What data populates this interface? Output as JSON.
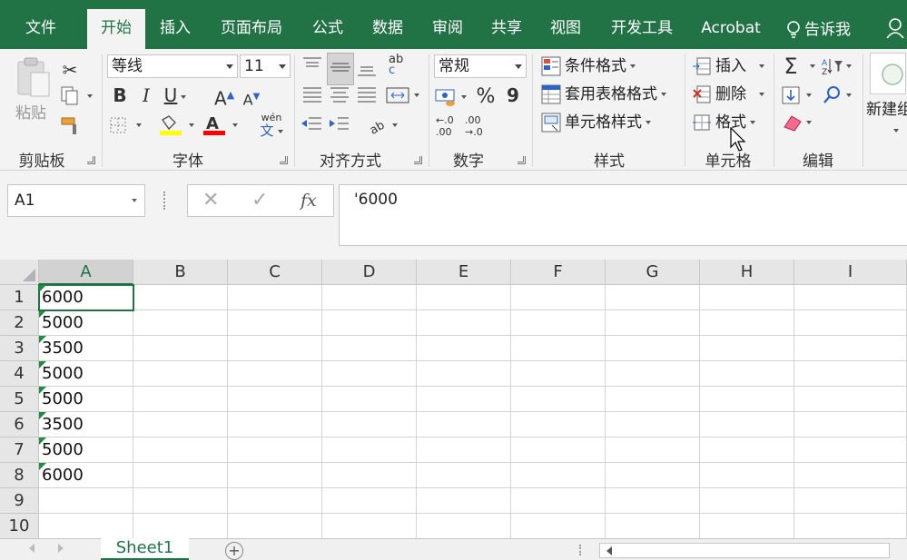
{
  "tabs": [
    "文件",
    "开始",
    "插入",
    "页面布局",
    "公式",
    "数据",
    "审阅",
    "共享",
    "视图",
    "开发工具",
    "Acrobat"
  ],
  "active_tab": "开始",
  "tell_me": "告诉我",
  "clipboard": {
    "paste": "粘贴",
    "group": "剪贴板"
  },
  "font": {
    "name": "等线",
    "size": "11",
    "group": "字体",
    "bold": "B",
    "italic": "I",
    "underline": "U",
    "grow": "A",
    "shrink": "A",
    "phonetic": "wén",
    "phonetic_char": "文",
    "highlight_color": "#ffff00",
    "font_color": "#ff0000"
  },
  "alignment": {
    "group": "对齐方式",
    "wrap": "ab",
    "wrap2": "c"
  },
  "number": {
    "format": "常规",
    "group": "数字",
    "percent": "%",
    "comma": "9",
    "inc": "←.0",
    "inc2": ".00",
    "dec": ".00",
    "dec2": "→.0"
  },
  "styles": {
    "group": "样式",
    "conditional": "条件格式",
    "table": "套用表格格式",
    "cell": "单元格样式"
  },
  "cells": {
    "group": "单元格",
    "insert": "插入",
    "delete": "删除",
    "format": "格式"
  },
  "editing": {
    "group": "编辑",
    "sum": "Σ"
  },
  "new": {
    "label": "新建组"
  },
  "formula_bar": {
    "name_box": "A1",
    "cancel": "✕",
    "enter": "✓",
    "fx": "fx",
    "content": "'6000"
  },
  "columns": [
    "A",
    "B",
    "C",
    "D",
    "E",
    "F",
    "G",
    "H",
    "I"
  ],
  "rows": [
    "1",
    "2",
    "3",
    "4",
    "5",
    "6",
    "7",
    "8",
    "9",
    "10"
  ],
  "column_a": [
    "6000",
    "5000",
    "3500",
    "5000",
    "5000",
    "3500",
    "5000",
    "6000",
    "",
    ""
  ],
  "sheet": {
    "name": "Sheet1",
    "add": "+"
  },
  "colors": {
    "accent": "#217346",
    "error_triangle": "#1e8e3e"
  }
}
